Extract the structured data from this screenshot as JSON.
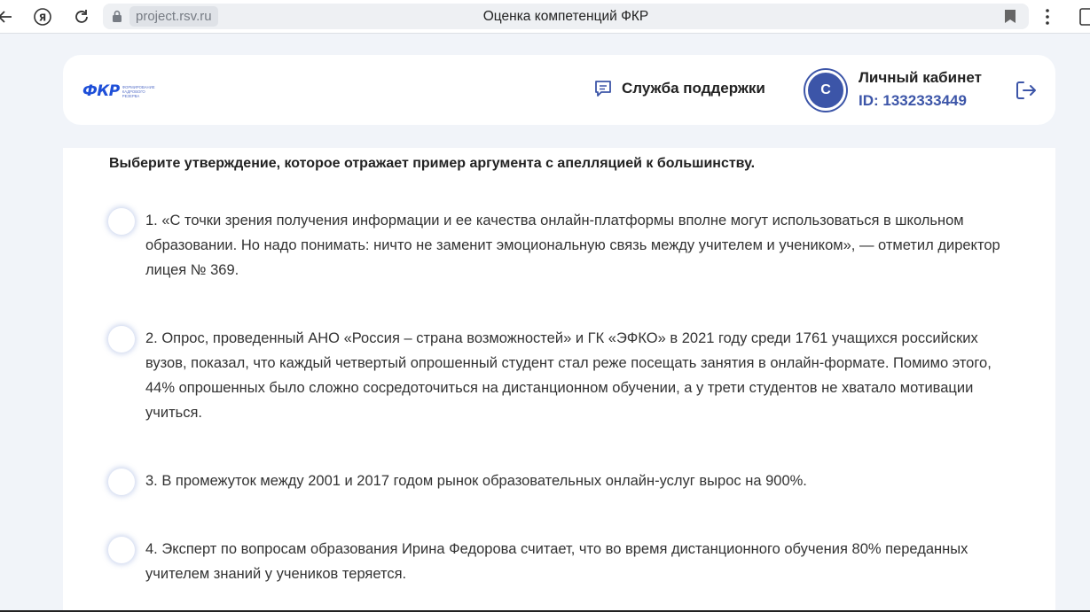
{
  "browser": {
    "url": "project.rsv.ru",
    "tab_title": "Оценка компетенций ФКР"
  },
  "header": {
    "logo_text": "ФКР",
    "logo_subtitle": "ФОРМИРОВАНИЕ КАДРОВОГО РЕЗЕРВА",
    "support_label": "Служба поддержки",
    "avatar_letter": "С",
    "cabinet_title": "Личный кабинет",
    "cabinet_id": "ID: 1332333449"
  },
  "question": {
    "text": "Выберите утверждение, которое отражает пример аргумента с апелляцией к большинству.",
    "answers": [
      {
        "text": "1. «С точки зрения получения информации и ее качества онлайн-платформы вполне могут использоваться в школьном образовании. Но надо понимать: ничто не заменит эмоциональную связь между учителем и учеником», — отметил директор лицея № 369."
      },
      {
        "text": "2. Опрос, проведенный АНО «Россия – страна возможностей» и ГК «ЭФКО» в 2021 году среди 1761 учащихся российских вузов, показал, что каждый четвертый опрошенный студент стал реже посещать занятия в онлайн-формате. Помимо этого, 44% опрошенных было сложно сосредоточиться на дистанционном обучении, а у трети студентов не хватало мотивации учиться."
      },
      {
        "text": "3. В промежуток между 2001 и 2017 годом рынок образовательных онлайн-услуг вырос на 900%."
      },
      {
        "text": "4. Эксперт по вопросам образования Ирина Федорова считает, что во время дистанционного обучения 80% переданных учителем знаний у учеников теряется."
      }
    ]
  },
  "colors": {
    "accent": "#3c55a8",
    "page_background": "#f1f4f9"
  }
}
